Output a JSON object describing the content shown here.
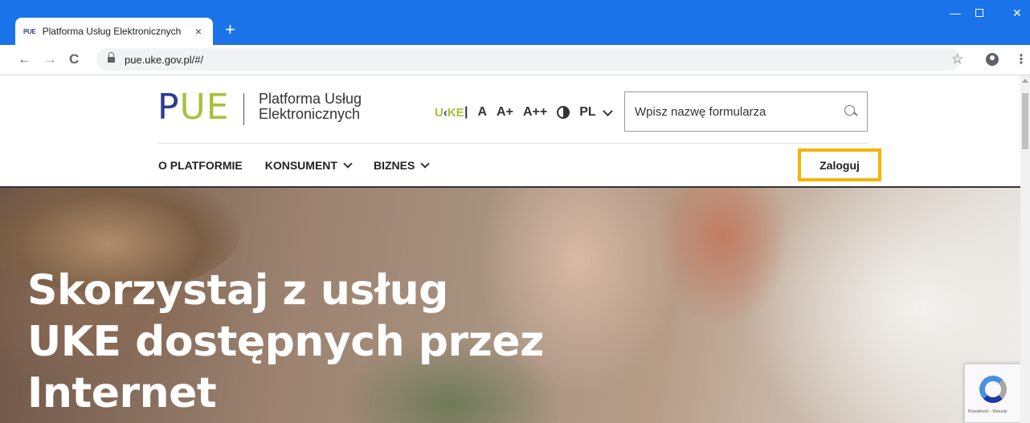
{
  "browser": {
    "tab": {
      "favicon_text": "PUE",
      "title": "Platforma Usług Elektronicznych",
      "close": "×"
    },
    "new_tab": "+",
    "window_controls": {
      "minimize": "—",
      "close": "✕"
    },
    "nav": {
      "back": "←",
      "forward": "→",
      "reload": "C"
    },
    "url": "pue.uke.gov.pl/#/",
    "icons": [
      "lock-icon",
      "star-icon",
      "profile-icon",
      "menu-icon"
    ],
    "star": "☆",
    "menu": "⋮",
    "accent_color": "#1a73e8"
  },
  "header": {
    "logo": {
      "p": "P",
      "ue": "UE",
      "line1": "Platforma Usług",
      "line2": "Elektronicznych"
    },
    "uke_logo": {
      "u": "U",
      "ke": "KE",
      "separator": "|"
    },
    "accessibility": {
      "size_normal": "A",
      "size_large": "A+",
      "size_larger": "A++",
      "language": "PL"
    },
    "search": {
      "placeholder": "Wpisz nazwę formularza",
      "value": ""
    },
    "colors": {
      "logo_blue": "#2b3d8f",
      "logo_green": "#a6c23a",
      "login_highlight": "#f4b400"
    }
  },
  "nav": {
    "items": [
      {
        "label": "O PLATFORMIE"
      },
      {
        "label": "KONSUMENT"
      },
      {
        "label": "BIZNES"
      }
    ],
    "login_label": "Zaloguj"
  },
  "hero": {
    "lines": [
      "Skorzystaj z usług",
      "UKE dostępnych przez",
      "Internet"
    ]
  },
  "recaptcha": {
    "text": "Prywatność - Warunki"
  }
}
